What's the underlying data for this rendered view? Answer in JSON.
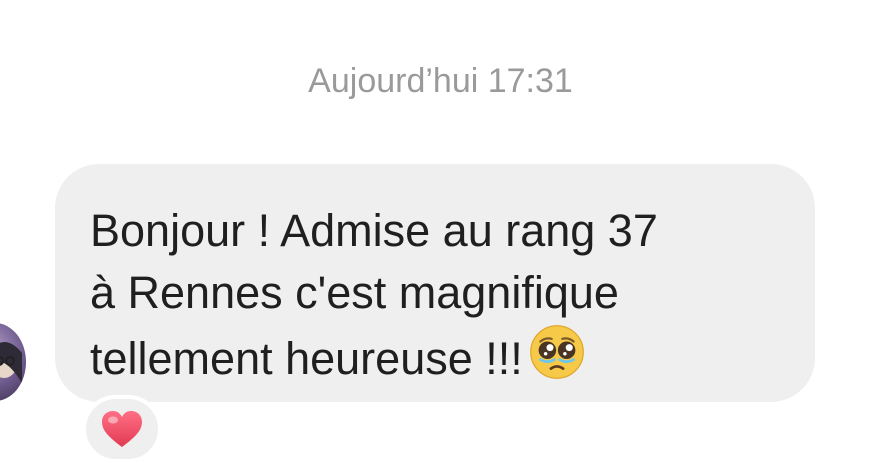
{
  "conversation": {
    "timestamp": "Aujourd’hui 17:31"
  },
  "message": {
    "text": "Bonjour ! Admise au rang 37\nà Rennes c'est magnifique \ntellement heureuse !!!",
    "emoji": "pleading-face-icon",
    "reaction": "heart-icon"
  },
  "colors": {
    "bubble": "#efefef",
    "timestamp": "#9a9a9a",
    "text": "#1f1f1f",
    "heart": "#e8425a"
  }
}
